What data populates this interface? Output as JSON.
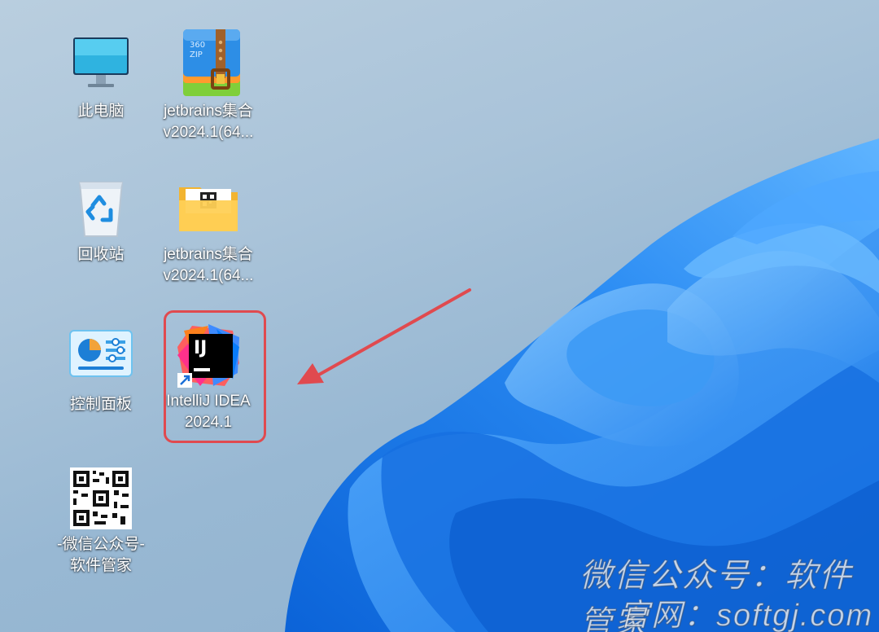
{
  "desktop": {
    "icons": [
      {
        "name": "this-pc",
        "lines": [
          "此电脑"
        ]
      },
      {
        "name": "jetbrains-zip",
        "lines": [
          "jetbrains集合",
          "v2024.1(64..."
        ]
      },
      {
        "name": "recycle-bin",
        "lines": [
          "回收站"
        ]
      },
      {
        "name": "jetbrains-folder",
        "lines": [
          "jetbrains集合",
          "v2024.1(64..."
        ]
      },
      {
        "name": "control-panel",
        "lines": [
          "控制面板"
        ]
      },
      {
        "name": "intellij-idea",
        "lines": [
          "IntelliJ IDEA",
          "2024.1"
        ]
      },
      {
        "name": "wechat-qr",
        "lines": [
          "-微信公众号-",
          "软件管家"
        ]
      }
    ],
    "zip_badge": [
      "360",
      "ZIP"
    ],
    "ij_logo_text": "IJ"
  },
  "watermark": {
    "line1": "微信公众号：软件管家",
    "line2": "官网：softgj.com"
  },
  "colors": {
    "highlight": "#e04a4f",
    "arrow": "#e04a4f",
    "bloom": "#1a73e8"
  }
}
